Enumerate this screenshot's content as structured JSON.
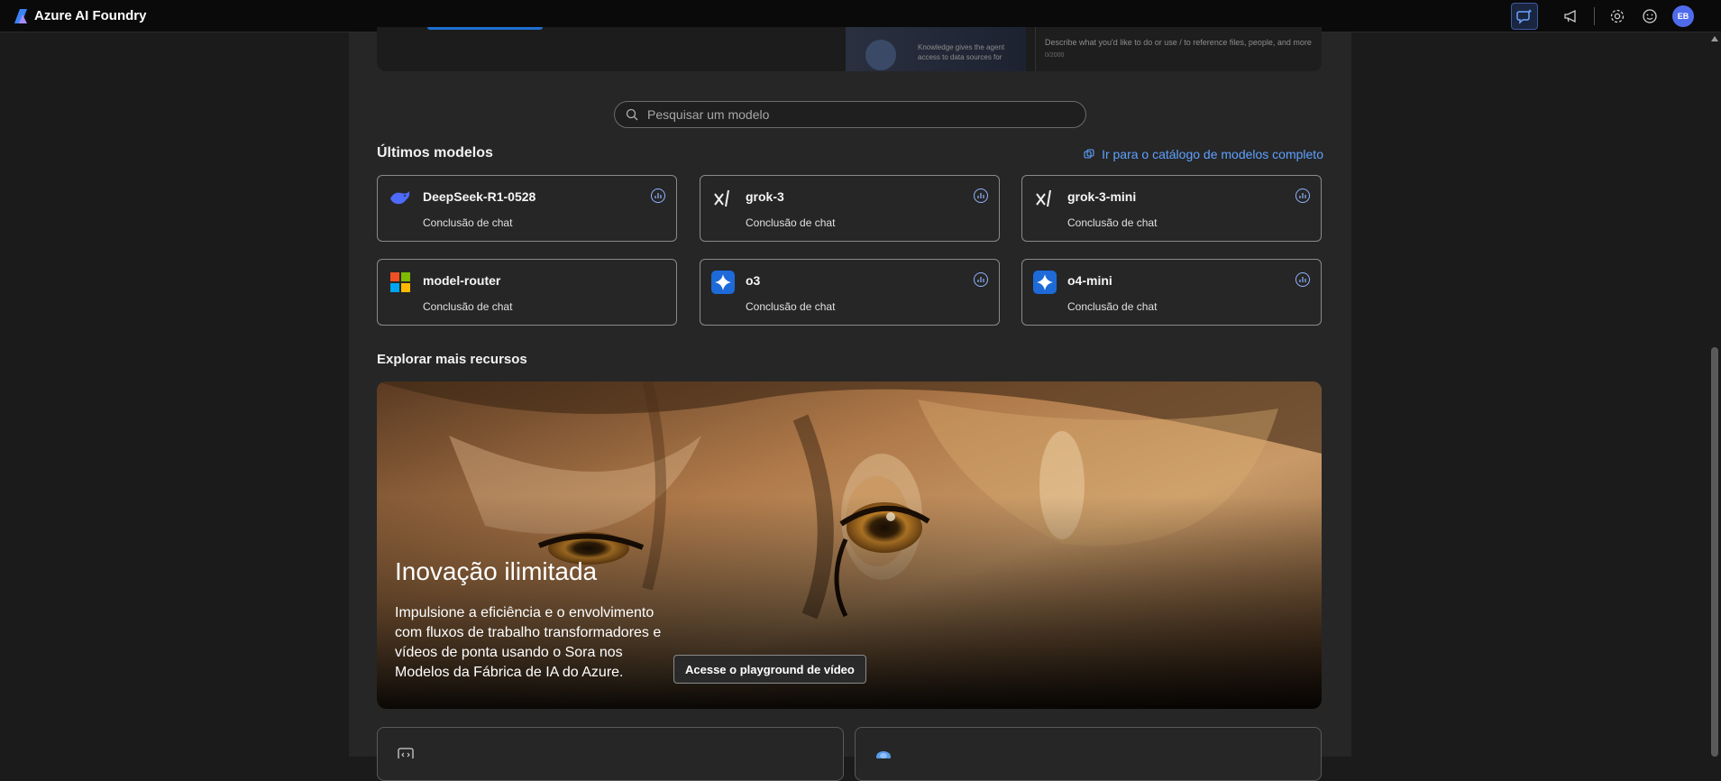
{
  "app": {
    "title": "Azure AI Foundry",
    "avatar_initials": "EB",
    "accent": "#4f6bed"
  },
  "top_card": {
    "preview_knowledge_text": "Knowledge gives the agent access to data sources for",
    "preview_prompt_text": "Describe what you'd like to do or use / to reference files, people, and more",
    "preview_counter": "0/2000"
  },
  "search": {
    "placeholder": "Pesquisar um modelo"
  },
  "latest_models": {
    "title": "Últimos modelos",
    "catalog_link": "Ir para o catálogo de modelos completo",
    "items": [
      {
        "name": "DeepSeek-R1-0528",
        "subtitle": "Conclusão de chat",
        "icon": "deepseek-whale-icon"
      },
      {
        "name": "grok-3",
        "subtitle": "Conclusão de chat",
        "icon": "xai-logo-icon"
      },
      {
        "name": "grok-3-mini",
        "subtitle": "Conclusão de chat",
        "icon": "xai-logo-icon"
      },
      {
        "name": "model-router",
        "subtitle": "Conclusão de chat",
        "icon": "microsoft-logo-icon"
      },
      {
        "name": "o3",
        "subtitle": "Conclusão de chat",
        "icon": "azure-openai-sparkle-icon"
      },
      {
        "name": "o4-mini",
        "subtitle": "Conclusão de chat",
        "icon": "azure-openai-sparkle-icon"
      }
    ]
  },
  "explore": {
    "title": "Explorar mais recursos",
    "hero": {
      "title": "Inovação ilimitada",
      "text": "Impulsione a eficiência e o envolvimento com fluxos de trabalho transformadores e vídeos de ponta usando o Sora nos Modelos da Fábrica de IA do Azure.",
      "button": "Acesse o playground de vídeo"
    }
  }
}
